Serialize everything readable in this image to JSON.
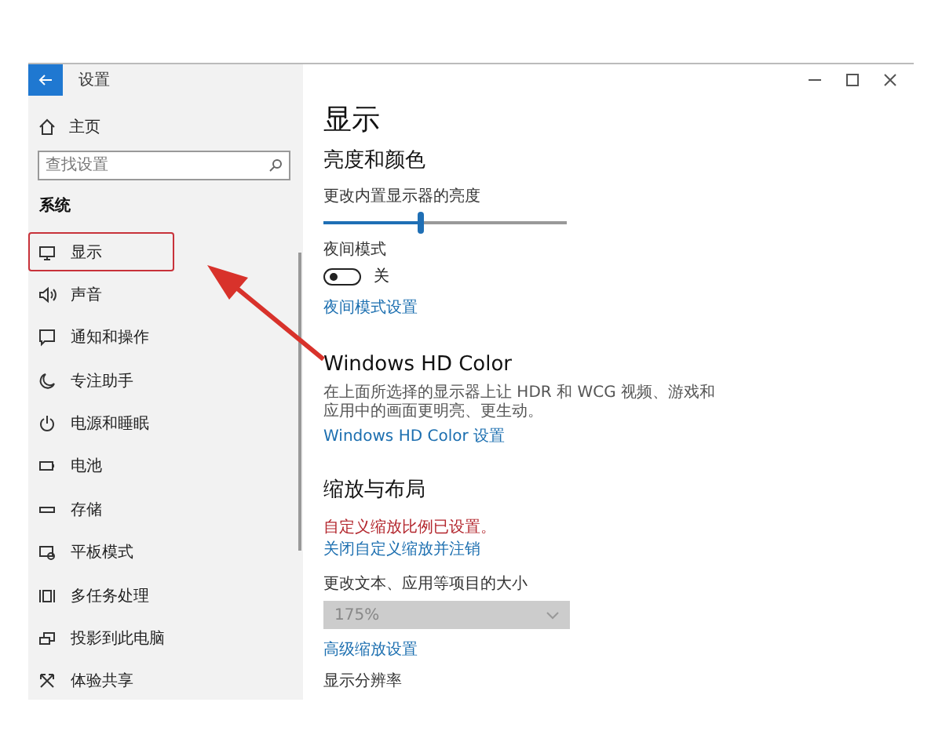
{
  "window": {
    "title": "设置"
  },
  "sidebar": {
    "home": "主页",
    "search": {
      "placeholder": "查找设置"
    },
    "section": "系统",
    "items": [
      {
        "label": "显示",
        "annotated": true
      },
      {
        "label": "声音",
        "annotated": false
      },
      {
        "label": "通知和操作",
        "annotated": false
      },
      {
        "label": "专注助手",
        "annotated": false
      },
      {
        "label": "电源和睡眠",
        "annotated": false
      },
      {
        "label": "电池",
        "annotated": false
      },
      {
        "label": "存储",
        "annotated": false
      },
      {
        "label": "平板模式",
        "annotated": false
      },
      {
        "label": "多任务处理",
        "annotated": false
      },
      {
        "label": "投影到此电脑",
        "annotated": false
      },
      {
        "label": "体验共享",
        "annotated": false
      }
    ]
  },
  "page": {
    "title": "显示",
    "brightness": {
      "heading": "亮度和颜色",
      "slider_label": "更改内置显示器的亮度",
      "level": 0.4,
      "night_label": "夜间模式",
      "night_on": false,
      "night_state": "关",
      "night_link": "夜间模式设置"
    },
    "hdr": {
      "heading": "Windows HD Color",
      "description": "在上面所选择的显示器上让 HDR 和 WCG 视频、游戏和应用中的画面更明亮、更生动。",
      "link": "Windows HD Color 设置"
    },
    "scale": {
      "heading": "缩放与布局",
      "warning": "自定义缩放比例已设置。",
      "warning_link": "关闭自定义缩放并注销",
      "size_label": "更改文本、应用等项目的大小",
      "size_value": "175%",
      "size_disabled": true,
      "advanced_link": "高级缩放设置",
      "resolution_label": "显示分辨率"
    }
  }
}
